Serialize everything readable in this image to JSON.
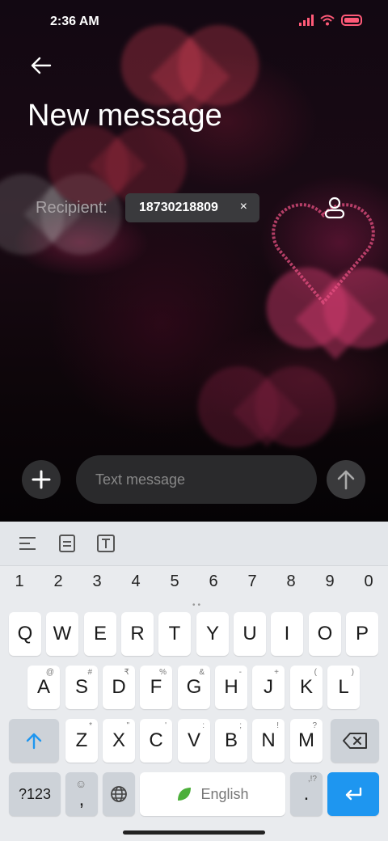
{
  "status_bar": {
    "time": "2:36 AM"
  },
  "header": {
    "title": "New message"
  },
  "recipient": {
    "label": "Recipient:",
    "number": "18730218809",
    "remove_glyph": "×"
  },
  "composer": {
    "placeholder": "Text message"
  },
  "keyboard": {
    "number_row": [
      "1",
      "2",
      "3",
      "4",
      "5",
      "6",
      "7",
      "8",
      "9",
      "0"
    ],
    "row1": [
      "Q",
      "W",
      "E",
      "R",
      "T",
      "Y",
      "U",
      "I",
      "O",
      "P"
    ],
    "row2": [
      {
        "key": "A",
        "hint": "@"
      },
      {
        "key": "S",
        "hint": "#"
      },
      {
        "key": "D",
        "hint": "₹"
      },
      {
        "key": "F",
        "hint": "%"
      },
      {
        "key": "G",
        "hint": "&"
      },
      {
        "key": "H",
        "hint": "-"
      },
      {
        "key": "J",
        "hint": "+"
      },
      {
        "key": "K",
        "hint": "("
      },
      {
        "key": "L",
        "hint": ")"
      }
    ],
    "row3": [
      {
        "key": "Z",
        "hint": "*"
      },
      {
        "key": "X",
        "hint": "\""
      },
      {
        "key": "C",
        "hint": "'"
      },
      {
        "key": "V",
        "hint": ":"
      },
      {
        "key": "B",
        "hint": ";"
      },
      {
        "key": "N",
        "hint": "!"
      },
      {
        "key": "M",
        "hint": "?"
      }
    ],
    "symbols_label": "?123",
    "comma_key": ",",
    "space_label": "English",
    "period_key": ".",
    "period_hint": ",!?"
  },
  "colors": {
    "accent": "#1e96f0",
    "chip_bg": "#3a3a3d",
    "battery": "#ff5a78"
  }
}
